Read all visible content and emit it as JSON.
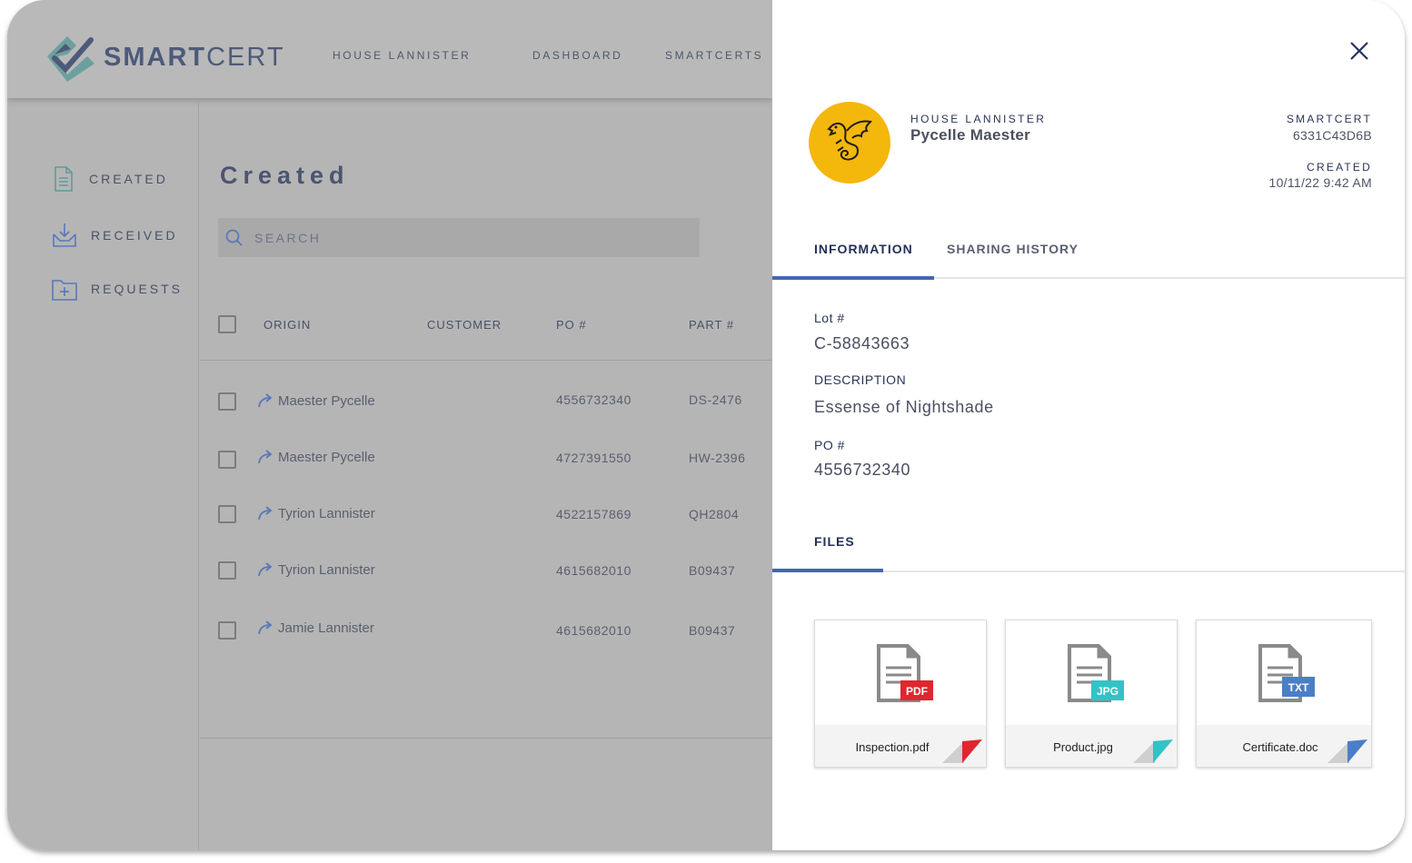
{
  "app": {
    "logo_text_bold": "SMART",
    "logo_text_light": "CERT",
    "nav": [
      "HOUSE LANNISTER",
      "DASHBOARD",
      "SMARTCERTS"
    ]
  },
  "sidebar": {
    "items": [
      {
        "label": "CREATED",
        "icon": "document-icon"
      },
      {
        "label": "RECEIVED",
        "icon": "inbox-download-icon"
      },
      {
        "label": "REQUESTS",
        "icon": "folder-plus-icon"
      }
    ]
  },
  "main": {
    "title": "Created",
    "search_placeholder": "SEARCH",
    "columns": [
      "ORIGIN",
      "CUSTOMER",
      "PO #",
      "PART #"
    ],
    "rows": [
      {
        "origin": "Maester Pycelle",
        "customer": "",
        "po": "4556732340",
        "part": "DS-2476"
      },
      {
        "origin": "Maester Pycelle",
        "customer": "",
        "po": "4727391550",
        "part": "HW-2396"
      },
      {
        "origin": "Tyrion Lannister",
        "customer": "",
        "po": "4522157869",
        "part": "QH2804"
      },
      {
        "origin": "Tyrion Lannister",
        "customer": "",
        "po": "4615682010",
        "part": "B09437"
      },
      {
        "origin": "Jamie Lannister",
        "customer": "",
        "po": "4615682010",
        "part": "B09437"
      }
    ]
  },
  "detail": {
    "org": "HOUSE LANNISTER",
    "person": "Pycelle Maester",
    "smartcert_label": "SMARTCERT",
    "smartcert_id": "6331C43D6B",
    "created_label": "CREATED",
    "created_value": "10/11/22 9:42 AM",
    "tabs": [
      "INFORMATION",
      "SHARING HISTORY"
    ],
    "active_tab": "INFORMATION",
    "fields": {
      "lot_label": "Lot #",
      "lot_value": "C-58843663",
      "desc_label": "DESCRIPTION",
      "desc_value": "Essense of Nightshade",
      "po_label": "PO #",
      "po_value": "4556732340"
    },
    "files_label": "FILES",
    "files": [
      {
        "name": "Inspection.pdf",
        "badge": "PDF",
        "color": "#e0262f"
      },
      {
        "name": "Product.jpg",
        "badge": "JPG",
        "color": "#33c2c6"
      },
      {
        "name": "Certificate.doc",
        "badge": "TXT",
        "color": "#4a7fc8"
      }
    ]
  },
  "colors": {
    "accent": "#4267b2",
    "avatar_bg": "#f4b70c",
    "overlay": "#b5b5b5"
  }
}
